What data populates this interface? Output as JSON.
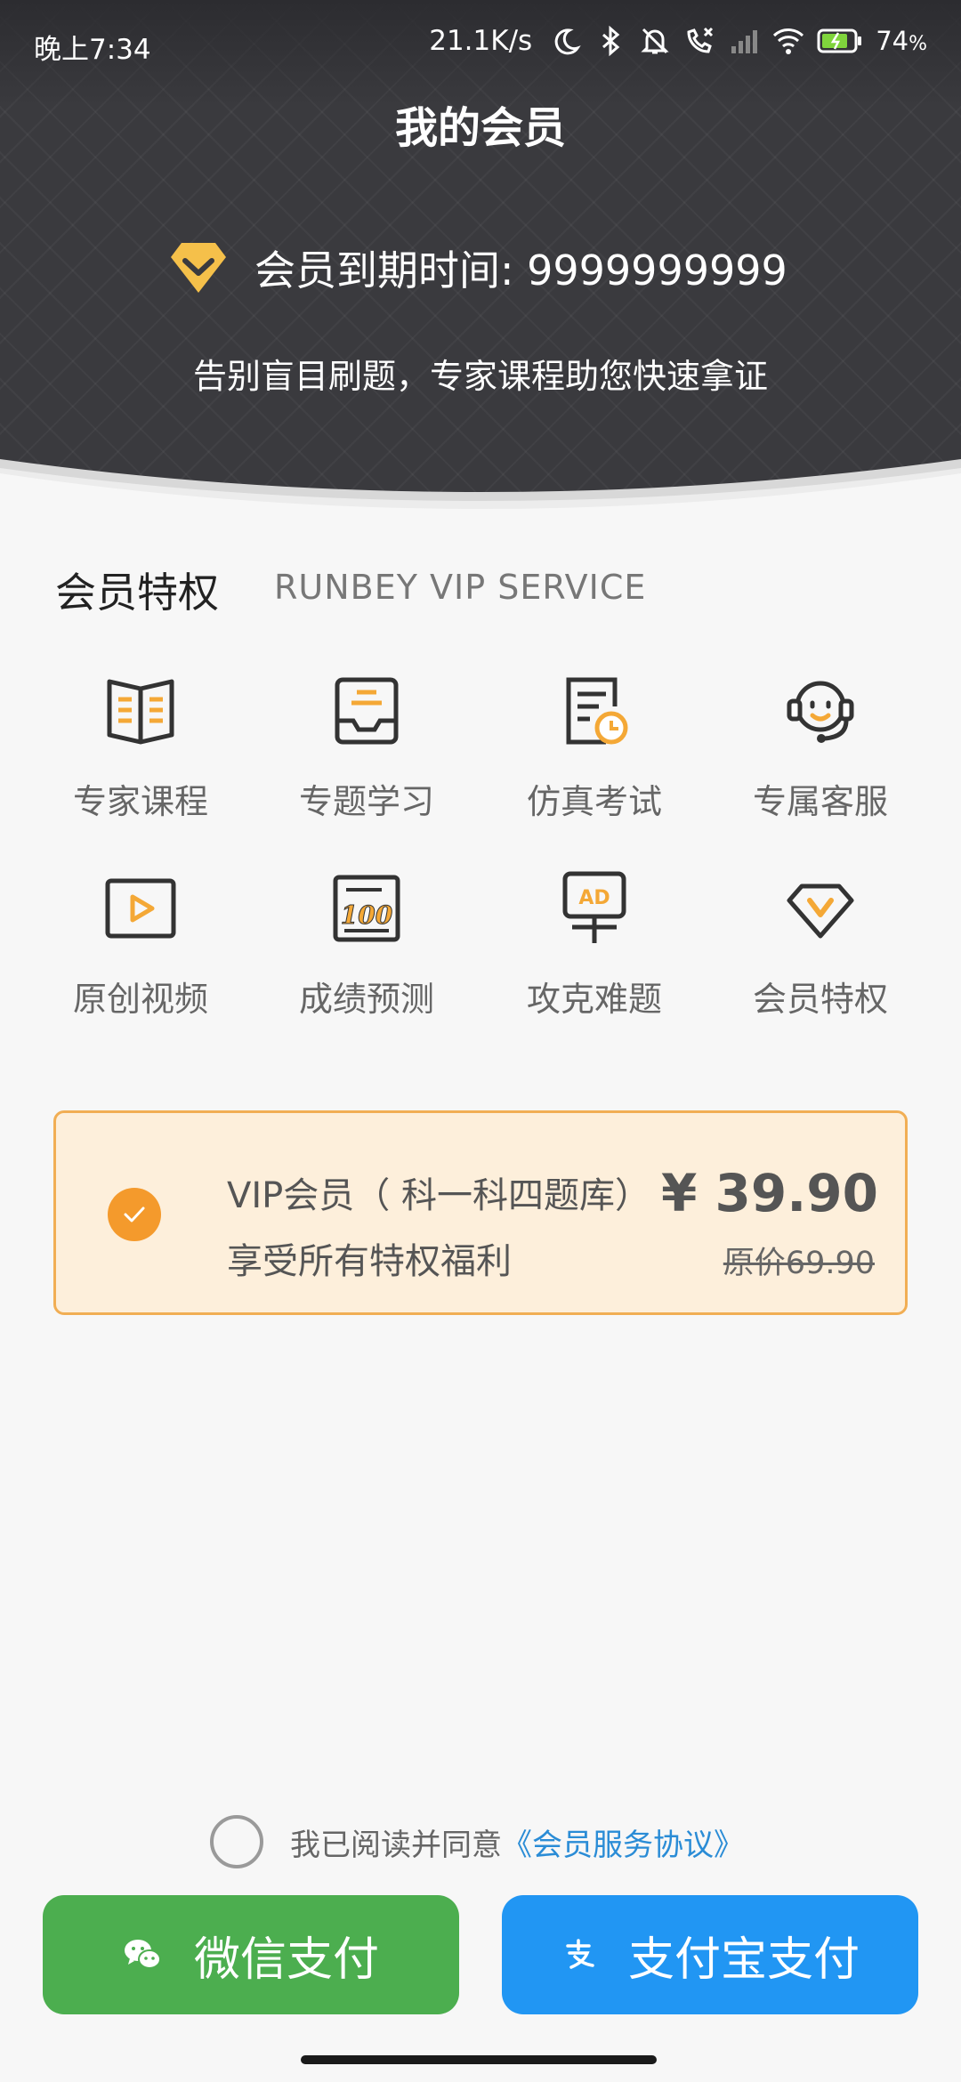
{
  "status_bar": {
    "time": "晚上7:34",
    "network_speed": "21.1K/s",
    "battery": "74",
    "icons": [
      "moon-icon",
      "bluetooth-icon",
      "mute-bell-icon",
      "call-forward-icon",
      "signal-icon",
      "wifi-icon",
      "battery-icon"
    ]
  },
  "header": {
    "title": "我的会员",
    "expire_text": "会员到期时间: 9999999999",
    "slogan": "告别盲目刷题，专家课程助您快速拿证"
  },
  "privileges": {
    "title": "会员特权",
    "subtitle": "RUNBEY VIP SERVICE",
    "items": [
      {
        "label": "专家课程",
        "icon": "open-book-icon"
      },
      {
        "label": "专题学习",
        "icon": "document-tray-icon"
      },
      {
        "label": "仿真考试",
        "icon": "exam-clock-icon"
      },
      {
        "label": "专属客服",
        "icon": "headset-icon"
      },
      {
        "label": "原创视频",
        "icon": "video-play-icon"
      },
      {
        "label": "成绩预测",
        "icon": "score-100-icon"
      },
      {
        "label": "攻克难题",
        "icon": "ad-sign-icon"
      },
      {
        "label": "会员特权",
        "icon": "diamond-v-icon"
      }
    ]
  },
  "plan": {
    "name": "VIP会员（ 科一科四题库）",
    "description": "享受所有特权福利",
    "price": "¥ 39.90",
    "original_price": "原价69.90",
    "selected": true
  },
  "agreement": {
    "text": "我已阅读并同意",
    "link": "《会员服务协议》",
    "checked": false
  },
  "payment": {
    "wechat_label": "微信支付",
    "alipay_label": "支付宝支付"
  },
  "colors": {
    "accent_orange": "#f49a2c",
    "gold": "#f5c04a",
    "wechat_green": "#4cae4f",
    "alipay_blue": "#2196f3",
    "link_blue": "#2a8cd6"
  }
}
